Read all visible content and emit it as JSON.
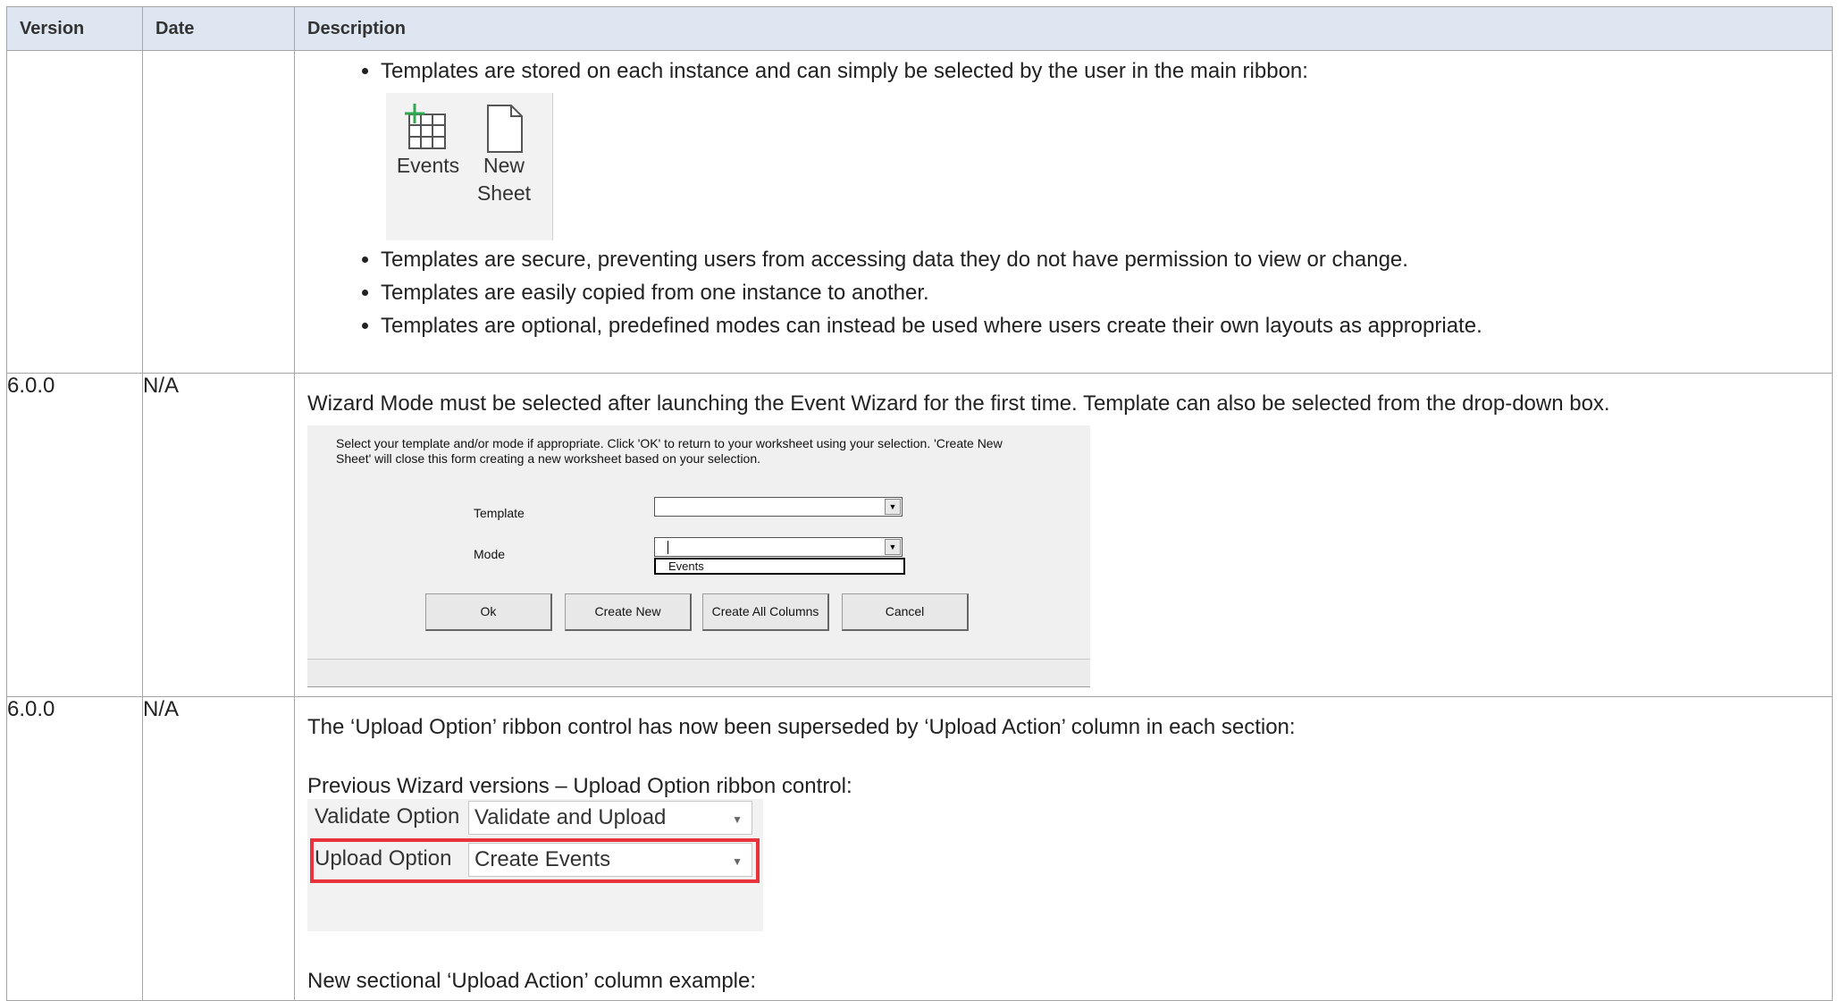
{
  "table": {
    "headers": {
      "version": "Version",
      "date": "Date",
      "description": "Description"
    }
  },
  "row1": {
    "bullets": [
      "Templates are stored on each instance and can simply be selected by the user in the main ribbon:",
      "Templates are secure, preventing users from accessing data they do not have permission to view or change.",
      "Templates are easily copied from one instance to another.",
      "Templates are optional, predefined modes can instead be used where users create their own layouts as appropriate."
    ],
    "ribbon": {
      "events_label": "Events",
      "new_label_line1": "New",
      "new_label_line2": "Sheet"
    }
  },
  "row2": {
    "version": "6.0.0",
    "date": "N/A",
    "text": "Wizard Mode must be selected after launching the Event Wizard for the first time. Template can also be selected from the drop-down box.",
    "wizard": {
      "message": "Select your template and/or mode if appropriate. Click 'OK' to return to your worksheet using your selection.  'Create New Sheet' will close this form creating a new worksheet based on your selection.",
      "template_label": "Template",
      "mode_label": "Mode",
      "mode_option": "Events",
      "buttons": {
        "ok": "Ok",
        "create_new": "Create New",
        "create_all": "Create All Columns",
        "cancel": "Cancel"
      }
    }
  },
  "row3": {
    "version": "6.0.0",
    "date": "N/A",
    "text": "The ‘Upload Option’ ribbon control has now been superseded by ‘Upload Action’ column in each section:",
    "previous_caption": "Previous Wizard versions – Upload Option ribbon control:",
    "controls": {
      "validate_label": "Validate Option",
      "validate_value": "Validate and Upload",
      "upload_label": "Upload Option",
      "upload_value": "Create Events"
    },
    "new_caption": "New sectional ‘Upload Action’ column example:"
  },
  "colors": {
    "header_bg": "#dde6f1",
    "highlight_red": "#e8323c",
    "border": "#a6a6a6"
  }
}
